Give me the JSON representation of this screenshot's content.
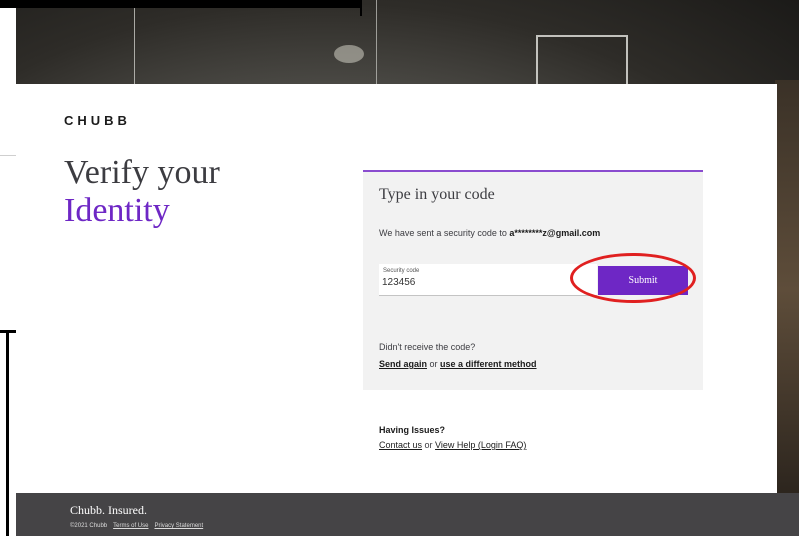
{
  "brand": "CHUBB",
  "headline": {
    "line1": "Verify your",
    "line2": "Identity"
  },
  "code_box": {
    "title": "Type in your code",
    "sent_prefix": "We have sent a security code to ",
    "sent_email": "a********z@gmail.com",
    "field_label": "Security code",
    "field_value": "123456",
    "submit_label": "Submit",
    "didnt_receive": "Didn't receive the code?",
    "send_again": "Send again",
    "or1": " or ",
    "different_method": "use a different method"
  },
  "issues": {
    "title": "Having Issues?",
    "contact": "Contact us",
    "or2": " or ",
    "help": "View Help (Login FAQ)"
  },
  "footer": {
    "brand": "Chubb. Insured.",
    "copyright": "©2021 Chubb",
    "terms": "Terms of Use",
    "privacy": "Privacy Statement"
  },
  "colors": {
    "accent": "#6e27c5",
    "annotation_circle": "#e02020",
    "footer_bg": "#454446"
  }
}
